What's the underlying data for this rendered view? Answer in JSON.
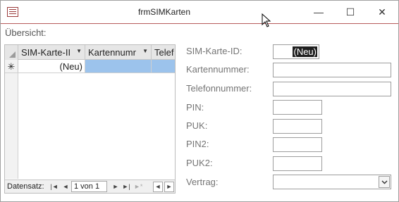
{
  "window": {
    "title": "frmSIMKarten",
    "minimize_symbol": "—",
    "maximize_symbol": "☐",
    "close_symbol": "✕"
  },
  "overview_label": "Übersicht:",
  "datasheet": {
    "columns": [
      "SIM-Karte-II",
      "Kartennumr",
      "Telef"
    ],
    "new_row_marker": "✳",
    "new_row_id_value": "(Neu)",
    "navigation": {
      "label": "Datensatz:",
      "record": "1 von 1",
      "first_symbol": "|◄",
      "prev_symbol": "◄",
      "next_symbol": "►",
      "last_symbol": "►|",
      "new_symbol": "►*"
    },
    "scroll_left_symbol": "◄",
    "scroll_right_symbol": "►"
  },
  "form": {
    "fields": [
      {
        "label": "SIM-Karte-ID:",
        "value": "(Neu)"
      },
      {
        "label": "Kartennummer:",
        "value": ""
      },
      {
        "label": "Telefonnummer:",
        "value": ""
      },
      {
        "label": "PIN:",
        "value": ""
      },
      {
        "label": "PUK:",
        "value": ""
      },
      {
        "label": "PIN2:",
        "value": ""
      },
      {
        "label": "PUK2:",
        "value": ""
      },
      {
        "label": "Vertrag:",
        "value": ""
      }
    ]
  },
  "colors": {
    "selection": "#9cc3ec",
    "title_accent": "#b65a5a"
  }
}
